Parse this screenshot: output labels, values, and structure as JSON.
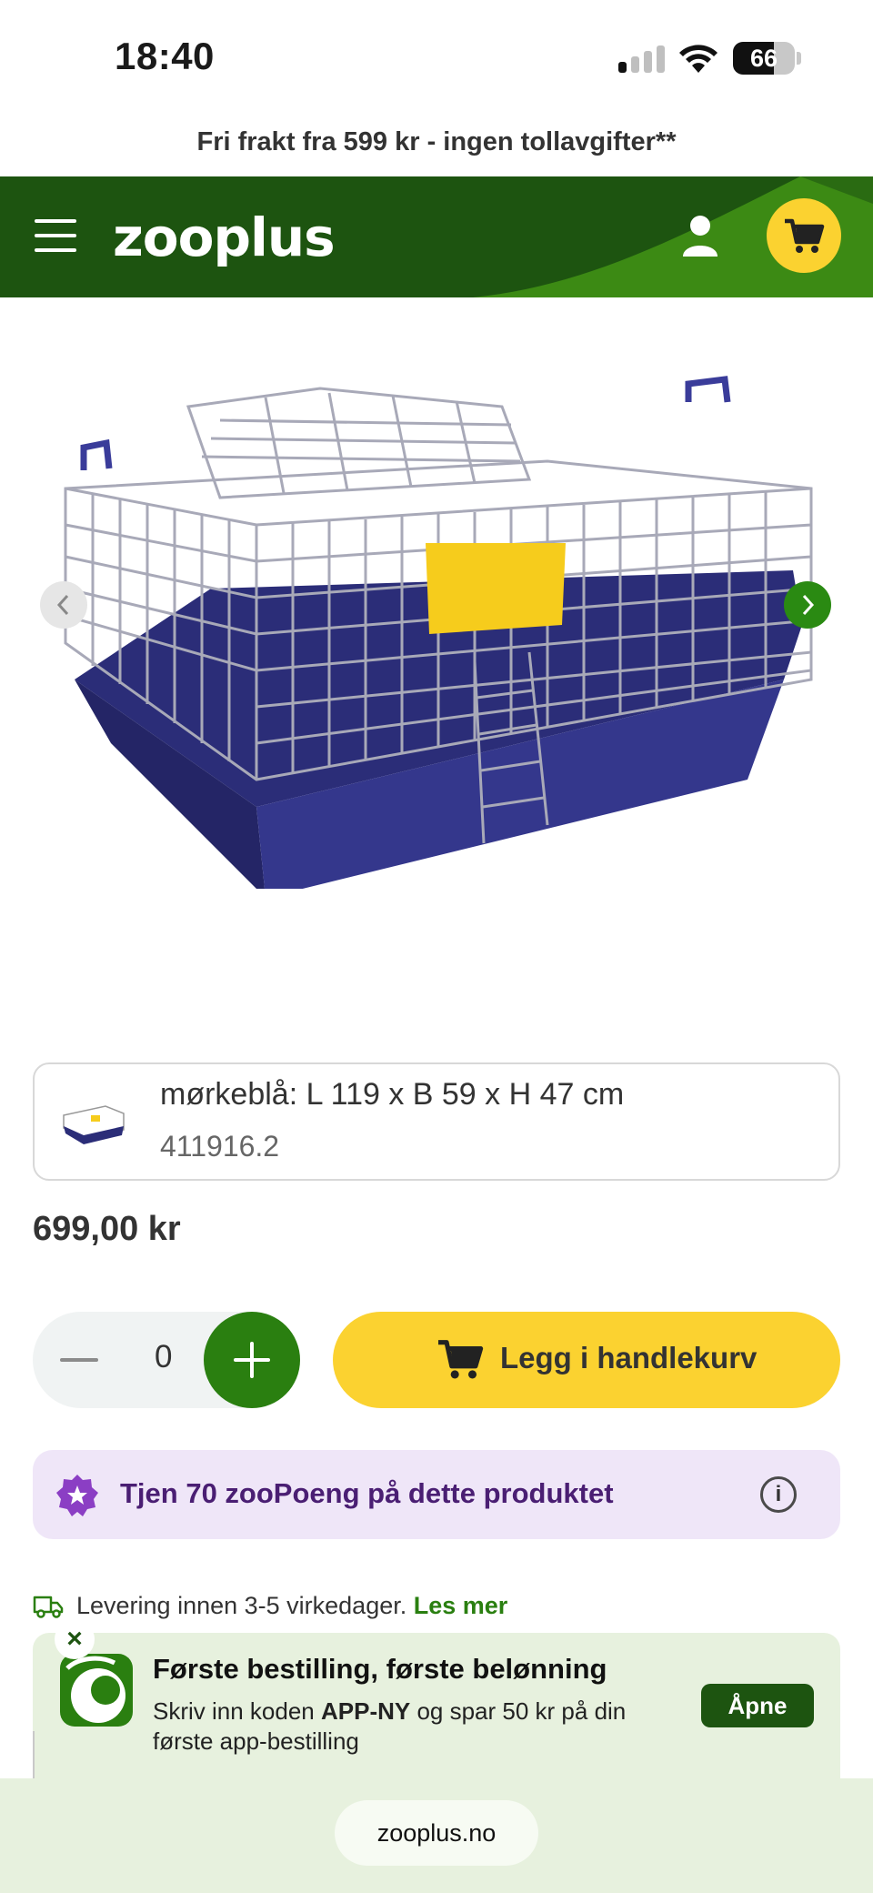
{
  "status_bar": {
    "time": "18:40",
    "battery": "66",
    "battery_level": 0.66
  },
  "promo_line": "Fri frakt fra 599 kr - ingen tollavgifter**",
  "header": {
    "logo": "zooplus",
    "menu_icon": "hamburger-icon",
    "account_icon": "user-icon",
    "cart_icon": "cart-icon"
  },
  "gallery": {
    "prev_icon": "chevron-left-icon",
    "next_icon": "chevron-right-icon",
    "image": "cage-product-image"
  },
  "variant": {
    "name": "mørkeblå: L 119 x B 59 x H 47 cm",
    "sku": "411916.2"
  },
  "price": "699,00 kr",
  "quantity": {
    "value": "0",
    "minus_icon": "minus-icon",
    "plus_icon": "plus-icon"
  },
  "add_to_cart": {
    "label": "Legg i handlekurv"
  },
  "points_banner": {
    "text": "Tjen 70 zooPoeng på dette produktet",
    "info": "i"
  },
  "delivery": {
    "text": "Levering innen 3-5 virkedager.",
    "link": "Les mer"
  },
  "app_banner": {
    "title": "Første bestilling, første belønning",
    "sub_before": "Skriv inn koden ",
    "code": "APP-NY",
    "sub_after": " og spar 50 kr på din første app-bestilling",
    "open_label": "Åpne",
    "close": "×"
  },
  "browser": {
    "url": "zooplus.no"
  },
  "colors": {
    "brand_green": "#1d5410",
    "accent_green": "#2a7f10",
    "yellow": "#fbd230",
    "purple": "#4a1e73"
  }
}
